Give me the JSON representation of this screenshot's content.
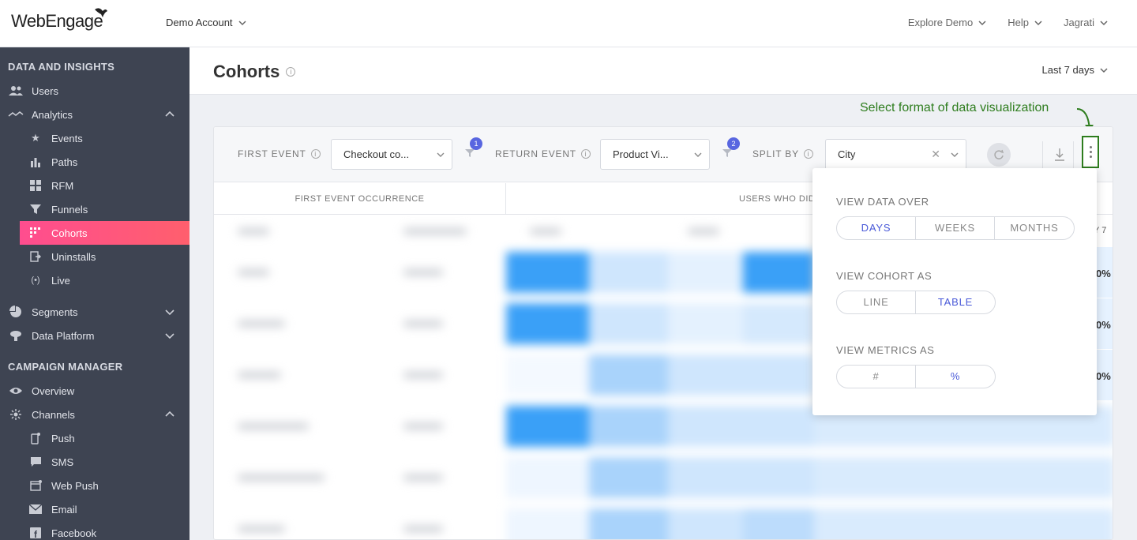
{
  "topbar": {
    "logo": "WebEngage",
    "account": "Demo Account",
    "nav": [
      "Explore Demo",
      "Help",
      "Jagrati"
    ]
  },
  "sidebar": {
    "section1": "DATA AND INSIGHTS",
    "users": "Users",
    "analytics": "Analytics",
    "events": "Events",
    "paths": "Paths",
    "rfm": "RFM",
    "funnels": "Funnels",
    "cohorts": "Cohorts",
    "uninstalls": "Uninstalls",
    "live": "Live",
    "segments": "Segments",
    "data_platform": "Data Platform",
    "section2": "CAMPAIGN MANAGER",
    "overview": "Overview",
    "channels": "Channels",
    "push": "Push",
    "sms": "SMS",
    "web_push": "Web Push",
    "email": "Email",
    "facebook": "Facebook"
  },
  "page": {
    "title": "Cohorts",
    "date_range": "Last 7 days",
    "annotation": "Select format of data visualization"
  },
  "toolbar": {
    "first_event_label": "FIRST EVENT",
    "first_event_value": "Checkout co...",
    "first_filter_count": "1",
    "return_event_label": "RETURN EVENT",
    "return_event_value": "Product Vi...",
    "return_filter_count": "2",
    "split_by_label": "SPLIT BY",
    "split_by_value": "City"
  },
  "table": {
    "col1_header": "FIRST EVENT OCCURRENCE",
    "col2_header": "USERS WHO DID",
    "day_header": "Y 7",
    "pct_values": [
      "0%",
      "0%",
      "0%"
    ]
  },
  "dropdown": {
    "view_data_over": "VIEW DATA OVER",
    "data_options": [
      "DAYS",
      "WEEKS",
      "MONTHS"
    ],
    "view_cohort_as": "VIEW COHORT AS",
    "cohort_options": [
      "LINE",
      "TABLE"
    ],
    "view_metrics_as": "VIEW METRICS AS",
    "metric_options": [
      "#",
      "%"
    ]
  },
  "colors": {
    "accent": "#5866e0",
    "active_nav": "#ff4d8f",
    "annotation": "#2e7d1e",
    "sidebar_bg": "#3e4452"
  }
}
